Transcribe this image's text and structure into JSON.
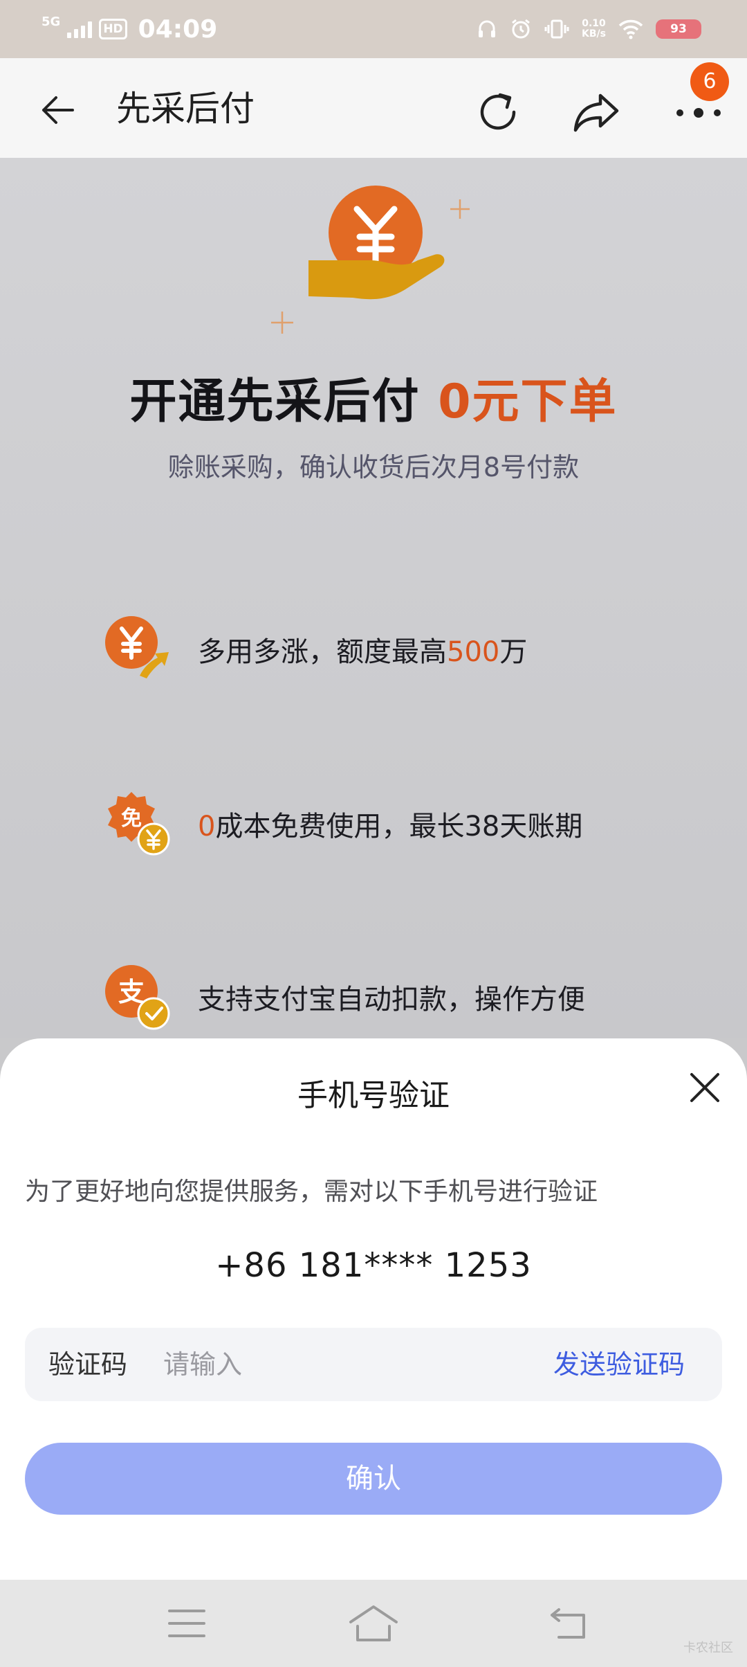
{
  "status_bar": {
    "network": "5G",
    "hd": "HD",
    "time": "04:09",
    "speed_value": "0.10",
    "speed_unit": "KB/s",
    "battery": "93"
  },
  "header": {
    "title": "先采后付",
    "badge_count": "6",
    "icons": [
      "back-arrow-icon",
      "refresh-icon",
      "share-icon",
      "more-icon"
    ]
  },
  "hero": {
    "title_main": "开通先采后付",
    "title_highlight": "0元下单",
    "subtitle": "赊账采购，确认收货后次月8号付款",
    "accent_color": "#d9541c"
  },
  "features": [
    {
      "icon": "yuan-up-icon",
      "text_before": "多用多涨，额度最高",
      "highlight": "500",
      "text_after": "万"
    },
    {
      "icon": "free-badge-icon",
      "text_before": "",
      "highlight": "0",
      "text_after": "成本免费使用，最长38天账期"
    },
    {
      "icon": "alipay-check-icon",
      "text_before": "支持支付宝自动扣款，操作方便",
      "highlight": "",
      "text_after": ""
    }
  ],
  "sheet": {
    "title": "手机号验证",
    "description": "为了更好地向您提供服务，需对以下手机号进行验证",
    "phone": "+86 181**** 1253",
    "code_label": "验证码",
    "code_placeholder": "请输入",
    "code_value": "",
    "send_code": "发送验证码",
    "confirm": "确认",
    "button_color": "#9aabf6",
    "link_color": "#3d5ce0"
  },
  "nav_bar": {
    "icons": [
      "menu-icon",
      "home-icon",
      "back-icon"
    ],
    "watermark": "卡农社区"
  }
}
